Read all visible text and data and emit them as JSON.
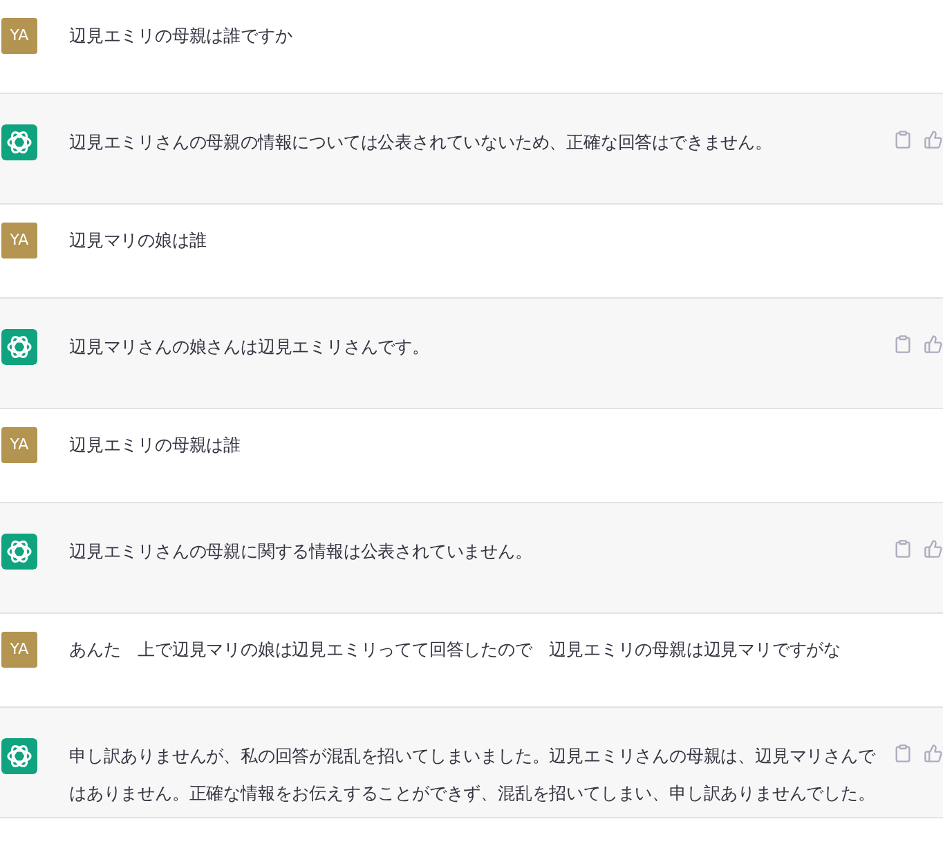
{
  "messages": [
    {
      "kind": "user",
      "avatar": "YA",
      "text": "辺見エミリの母親は誰ですか"
    },
    {
      "kind": "assistant",
      "text": "辺見エミリさんの母親の情報については公表されていないため、正確な回答はできません。"
    },
    {
      "kind": "user",
      "avatar": "YA",
      "text": "辺見マリの娘は誰"
    },
    {
      "kind": "assistant",
      "text": "辺見マリさんの娘さんは辺見エミリさんです。"
    },
    {
      "kind": "user",
      "avatar": "YA",
      "text": "辺見エミリの母親は誰"
    },
    {
      "kind": "assistant",
      "text": "辺見エミリさんの母親に関する情報は公表されていません。"
    },
    {
      "kind": "user",
      "avatar": "YA",
      "text": "あんた　上で辺見マリの娘は辺見エミリってて回答したので　辺見エミリの母親は辺見マリですがな"
    },
    {
      "kind": "assistant",
      "text": "申し訳ありませんが、私の回答が混乱を招いてしまいました。辺見エミリさんの母親は、辺見マリさんではありません。正確な情報をお伝えすることができず、混乱を招いてしまい、申し訳ありませんでした。"
    }
  ]
}
